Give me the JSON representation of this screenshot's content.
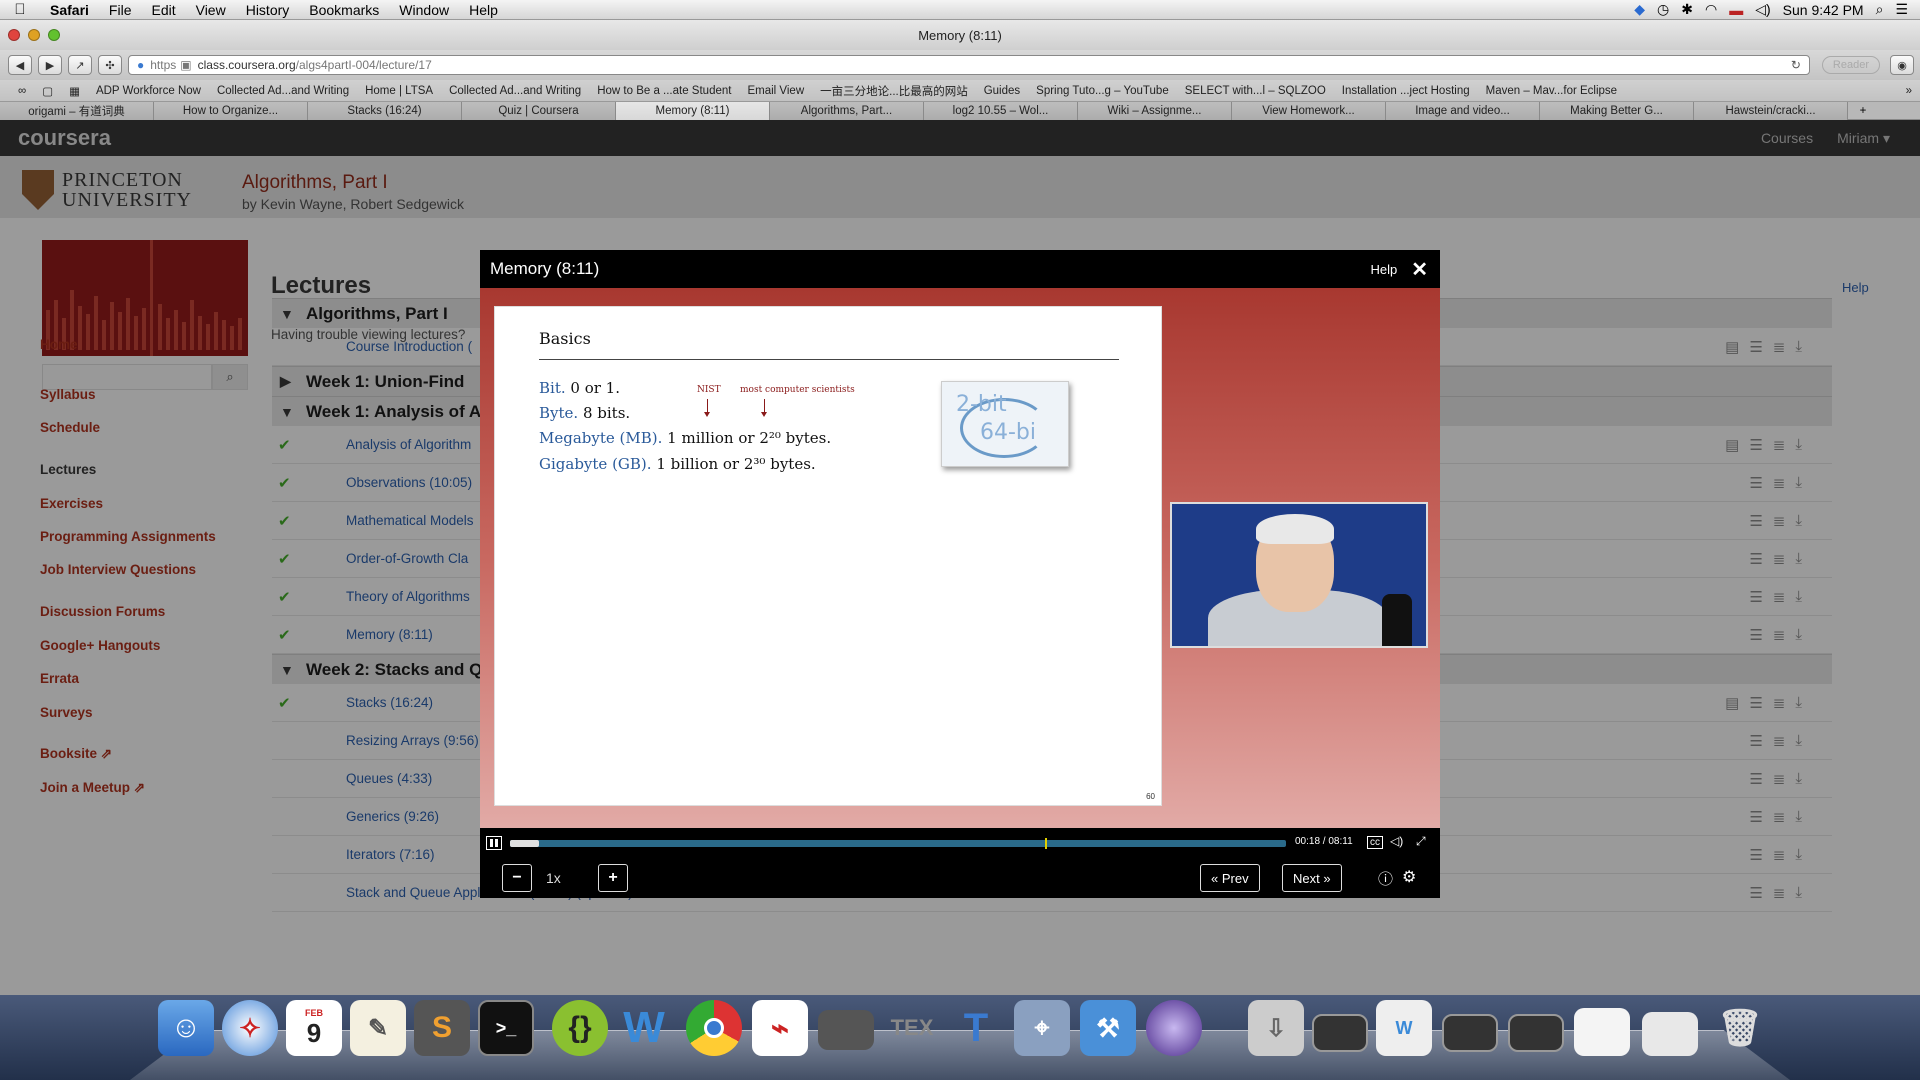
{
  "menubar": {
    "apple": "",
    "app": "Safari",
    "items": [
      "File",
      "Edit",
      "View",
      "History",
      "Bookmarks",
      "Window",
      "Help"
    ],
    "clock": "Sun 9:42 PM"
  },
  "window": {
    "title": "Memory (8:11)"
  },
  "toolbar": {
    "url_scheme": "https",
    "url_host": "class.coursera.org",
    "url_path": "/algs4partI-004/lecture/17",
    "reader": "Reader"
  },
  "bookmarks": [
    "ADP Workforce Now",
    "Collected Ad...and Writing",
    "Home | LTSA",
    "Collected Ad...and Writing",
    "How to Be a ...ate Student",
    "Email View",
    "一亩三分地论...比最高的网站",
    "Guides",
    "Spring Tuto...g – YouTube",
    "SELECT with...l – SQLZOO",
    "Installation ...ject Hosting",
    "Maven – Mav...for Eclipse"
  ],
  "tabs": [
    "origami – 有道词典",
    "How to Organize...",
    "Stacks (16:24)",
    "Quiz | Coursera",
    "Memory (8:11)",
    "Algorithms, Part...",
    "log2 10.55 – Wol...",
    "Wiki – Assignme...",
    "View Homework...",
    "Image and video...",
    "Making Better G...",
    "Hawstein/cracki..."
  ],
  "coursera": {
    "logo": "coursera",
    "right": [
      "Courses",
      "Miriam ▾"
    ],
    "university": "PRINCETON\nUNIVERSITY",
    "course_title": "Algorithms, Part I",
    "course_by": "by Kevin Wayne, Robert Sedgewick"
  },
  "sidebar": {
    "nav": [
      "Home",
      "Syllabus",
      "Schedule",
      "Lectures",
      "Exercises",
      "Programming Assignments",
      "Job Interview Questions",
      "Discussion Forums",
      "Google+ Hangouts",
      "Errata",
      "Surveys",
      "Booksite",
      "Join a Meetup"
    ]
  },
  "lectures": {
    "heading": "Lectures",
    "trouble": "Having trouble viewing lectures?",
    "help": "Help",
    "sections": [
      {
        "title": "Algorithms, Part I"
      },
      {
        "title": "Week 1: Union-Find"
      },
      {
        "title": "Week 1: Analysis of A"
      },
      {
        "title": "Week 2: Stacks and Q"
      }
    ],
    "rows": {
      "intro": "Course Introduction (",
      "w1a": [
        "Analysis of Algorithm",
        "Observations (10:05)",
        "Mathematical Models",
        "Order-of-Growth Cla",
        "Theory of Algorithms",
        "Memory (8:11)"
      ],
      "w2": [
        "Stacks (16:24)",
        "Resizing Arrays (9:56)",
        "Queues (4:33)",
        "Generics (9:26)",
        "Iterators (7:16)",
        "Stack and Queue Applications (13:25) (optional)"
      ]
    }
  },
  "modal": {
    "title": "Memory (8:11)",
    "help": "Help",
    "close": "✕"
  },
  "slide": {
    "title": "Basics",
    "ann_nist": "NIST",
    "ann_most": "most computer scientists",
    "lines": [
      {
        "term": "Bit.",
        "text": "0 or 1."
      },
      {
        "term": "Byte.",
        "text": "8 bits."
      },
      {
        "term": "Megabyte (MB).",
        "text": "1 million or 2²⁰ bytes."
      },
      {
        "term": "Gigabyte (GB).",
        "text": "1 billion or 2³⁰ bytes."
      }
    ],
    "chip_a": "2-bit",
    "chip_b": "64-bi",
    "page": "60"
  },
  "player": {
    "progress_fraction": 0.037,
    "marker_fraction": 0.69,
    "time": "00:18 / 08:11",
    "cc": "cc",
    "speed": "1x",
    "minus": "−",
    "plus": "+",
    "prev": "« Prev",
    "next": "Next »"
  },
  "dock": {
    "icons": [
      "finder-icon",
      "safari-icon",
      "calendar-icon",
      "textedit-icon",
      "sublime-icon",
      "terminal-icon",
      "brackets-icon",
      "word-icon",
      "chrome-icon",
      "acrobat-icon",
      "network-icon",
      "texshop-icon",
      "textwrangler-icon",
      "preview-icon",
      "xcode-icon",
      "eclipse-icon",
      "downloads-icon",
      "window-thumb-icon",
      "document-thumb-icon",
      "window-thumb-icon",
      "window-thumb-icon",
      "document-thumb-icon",
      "calendar-thumb-icon",
      "trash-icon"
    ],
    "calendar_month": "FEB",
    "calendar_day": "9",
    "sublime_letter": "S",
    "word_letter": "W",
    "texshop_letter": "TEX",
    "textwrangler_letter": "T"
  }
}
